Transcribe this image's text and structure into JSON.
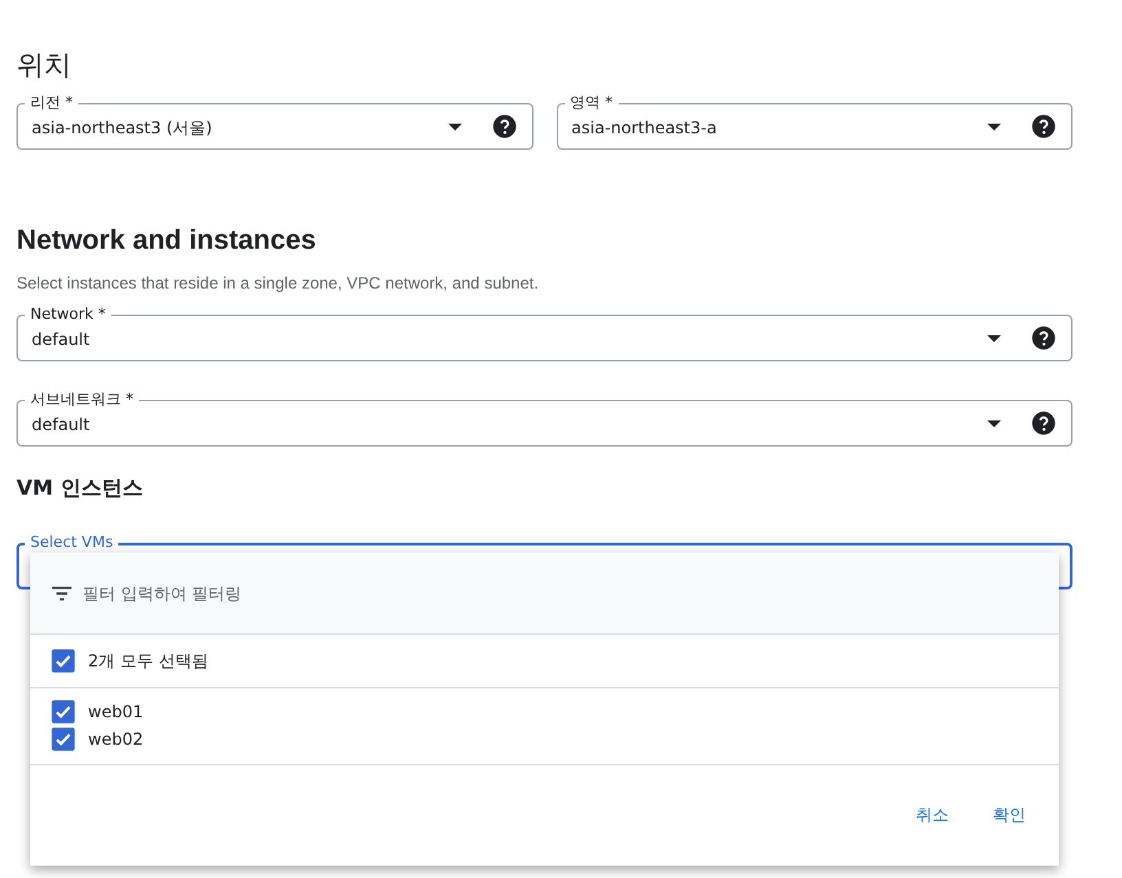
{
  "location": {
    "title": "위치",
    "fields": [
      {
        "label": "리전 *",
        "value": "asia-northeast3 (서울)",
        "help": true
      },
      {
        "label": "영역 *",
        "value": "asia-northeast3-a",
        "help": true
      }
    ]
  },
  "network": {
    "title": "Network and instances",
    "description": "Select instances that reside in a single zone, VPC network, and subnet.",
    "fields": [
      {
        "label": "Network *",
        "value": "default",
        "help": true
      },
      {
        "label": "서브네트워크 *",
        "value": "default",
        "help": true
      }
    ]
  },
  "vm_instances": {
    "title": "VM 인스턴스",
    "select": {
      "label": "Select VMs",
      "focused": true
    }
  },
  "menu": {
    "filter_placeholder": "필터 입력하여 필터링",
    "select_all": {
      "label": "2개 모두 선택됨",
      "checked": true
    },
    "items": [
      {
        "label": "web01",
        "checked": true
      },
      {
        "label": "web02",
        "checked": true
      }
    ],
    "buttons": [
      "취소",
      "확인"
    ]
  }
}
